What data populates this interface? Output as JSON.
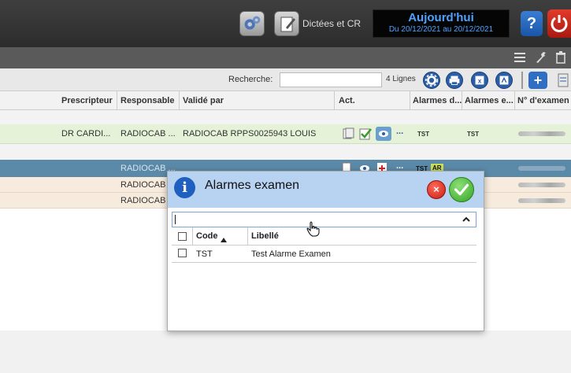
{
  "topbar": {
    "dictees_label": "Dictées et CR",
    "today_title": "Aujourd'hui",
    "today_range": "Du 20/12/2021 au 20/12/2021",
    "help_label": "?"
  },
  "toolbar": {
    "search_label": "Recherche:",
    "search_value": "",
    "lines_count": "4 Lignes",
    "add_label": "+"
  },
  "table": {
    "headers": [
      "Prescripteur",
      "Responsable",
      "Validé par",
      "Act.",
      "Alarmes d...",
      "Alarmes e...",
      "N° d'examen"
    ],
    "rows": [
      {
        "prescripteur": "DR CARDI...",
        "responsable": "RADIOCAB ...",
        "valide_par": "RADIOCAB RPPS0025943 LOUIS",
        "alarme_d": "TST",
        "alarme_e": "TST"
      },
      {
        "prescripteur": "",
        "responsable": "RADIOCAB ...",
        "valide_par": "",
        "alarme_d": "TST",
        "alarme_d_badge": "AR",
        "alarme_e": ""
      },
      {
        "prescripteur": "",
        "responsable": "RADIOCAB",
        "valide_par": "",
        "alarme_d": "",
        "alarme_e": ""
      },
      {
        "prescripteur": "",
        "responsable": "RADIOCAB",
        "valide_par": "",
        "alarme_d": "",
        "alarme_e": ""
      }
    ]
  },
  "dialog": {
    "title": "Alarmes examen",
    "cancel_label": "×",
    "input_value": "",
    "columns": {
      "code": "Code",
      "libelle": "Libellé"
    },
    "items": [
      {
        "code": "TST",
        "libelle": "Test Alarme Examen",
        "checked": false
      }
    ]
  },
  "colors": {
    "header_bg": "#b8d3f2",
    "selected_row": "#5b89a8",
    "green_row": "#e6f2d8",
    "orange_row": "#f6ebdc",
    "accent_blue": "#2a5fa8"
  }
}
